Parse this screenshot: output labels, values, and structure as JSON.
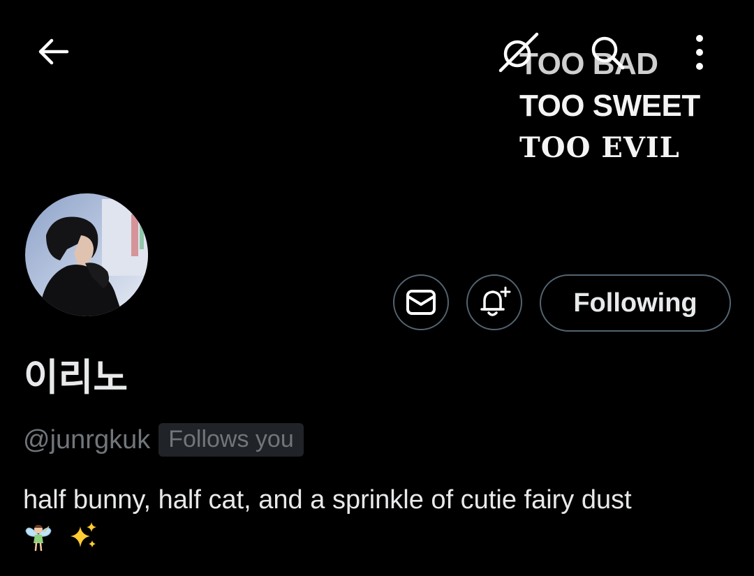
{
  "banner": {
    "lines": [
      "TOO BAD",
      "TOO SWEET",
      "TOO EVIL"
    ]
  },
  "topbar": {
    "back_icon": "arrow-left-icon",
    "grok_icon": "grok-icon",
    "search_icon": "search-icon",
    "more_icon": "more-vertical-icon"
  },
  "profile": {
    "display_name": "이리노",
    "handle": "@junrgkuk",
    "follows_you": "Follows you",
    "bio": "half bunny, half cat, and a sprinkle of cutie fairy dust",
    "bio_emoji": [
      "fairy-emoji",
      "sparkles-emoji"
    ]
  },
  "actions": {
    "message_icon": "envelope-icon",
    "notify_icon": "bell-plus-icon",
    "follow_label": "Following"
  },
  "colors": {
    "background": "#000000",
    "text_primary": "#e7e9ea",
    "text_secondary": "#71767b",
    "border": "#536471",
    "badge_bg": "#202327"
  }
}
